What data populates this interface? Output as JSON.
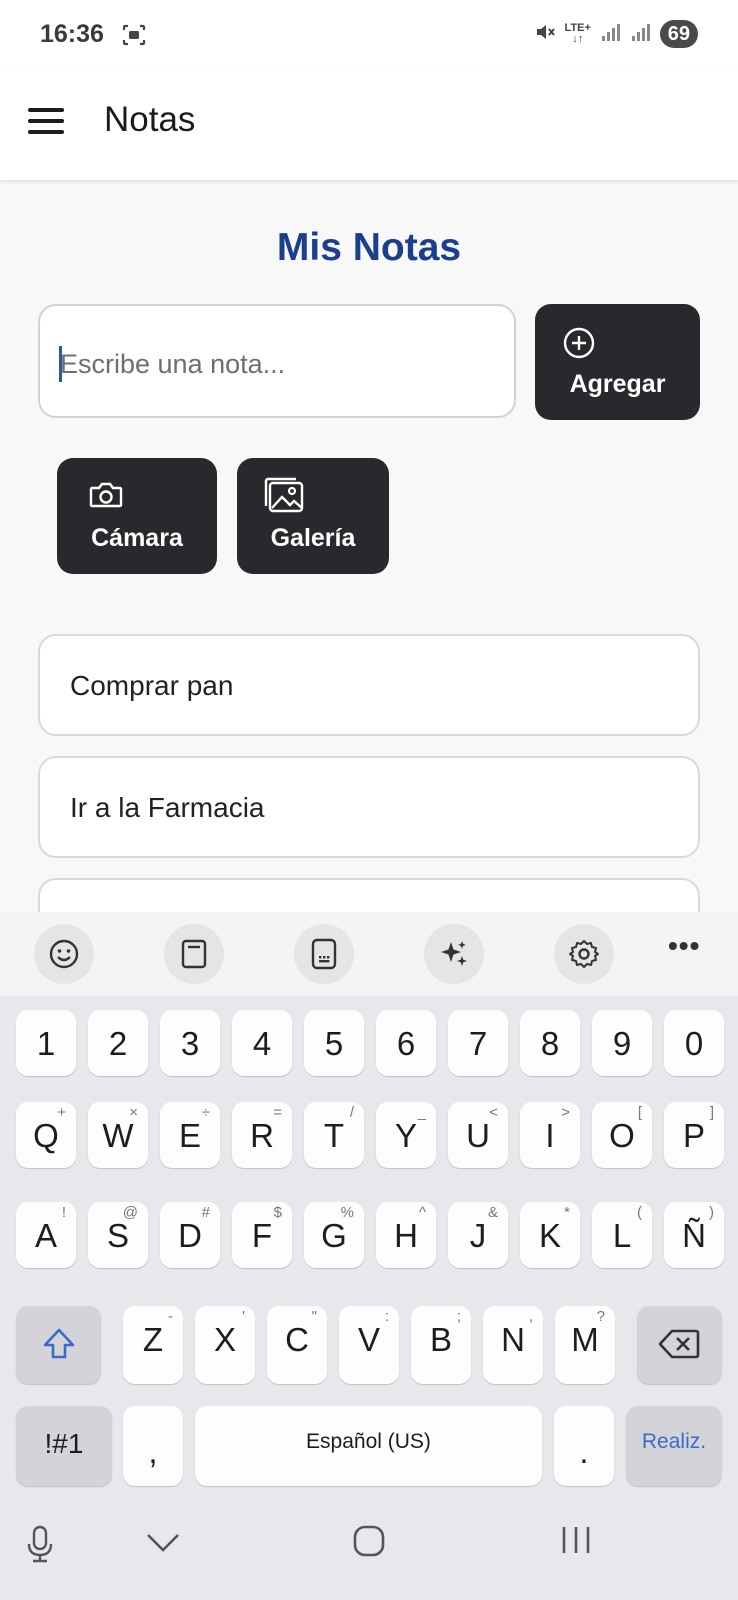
{
  "status_bar": {
    "time": "16:36",
    "network": "LTE+",
    "battery": "69"
  },
  "app_bar": {
    "title": "Notas"
  },
  "main": {
    "heading": "Mis Notas",
    "input": {
      "value": "",
      "placeholder": "Escribe una nota..."
    },
    "add_button": "Agregar",
    "camera_button": "Cámara",
    "gallery_button": "Galería",
    "notes": [
      "Comprar pan",
      "Ir a la Farmacia",
      ""
    ]
  },
  "keyboard": {
    "numbers": [
      "1",
      "2",
      "3",
      "4",
      "5",
      "6",
      "7",
      "8",
      "9",
      "0"
    ],
    "row1": [
      [
        "Q",
        "+"
      ],
      [
        "W",
        "×"
      ],
      [
        "E",
        "÷"
      ],
      [
        "R",
        "="
      ],
      [
        "T",
        "/"
      ],
      [
        "Y",
        "_"
      ],
      [
        "U",
        "<"
      ],
      [
        "I",
        ">"
      ],
      [
        "O",
        "["
      ],
      [
        "P",
        "]"
      ]
    ],
    "row2": [
      [
        "A",
        "!"
      ],
      [
        "S",
        "@"
      ],
      [
        "D",
        "#"
      ],
      [
        "F",
        "$"
      ],
      [
        "G",
        "%"
      ],
      [
        "H",
        "^"
      ],
      [
        "J",
        "&"
      ],
      [
        "K",
        "*"
      ],
      [
        "L",
        "("
      ],
      [
        "Ñ",
        ")"
      ]
    ],
    "row3": [
      [
        "Z",
        "-"
      ],
      [
        "X",
        "'"
      ],
      [
        "C",
        "\""
      ],
      [
        "V",
        ":"
      ],
      [
        "B",
        ";"
      ],
      [
        "N",
        ","
      ],
      [
        "M",
        "?"
      ]
    ],
    "symbols_key": "!#1",
    "comma_key": ",",
    "space_key": "Español (US)",
    "period_key": ".",
    "done_key": "Realiz."
  },
  "colors": {
    "heading": "#1c3f8c",
    "button": "#28292c",
    "accent": "#3a6bc8"
  }
}
